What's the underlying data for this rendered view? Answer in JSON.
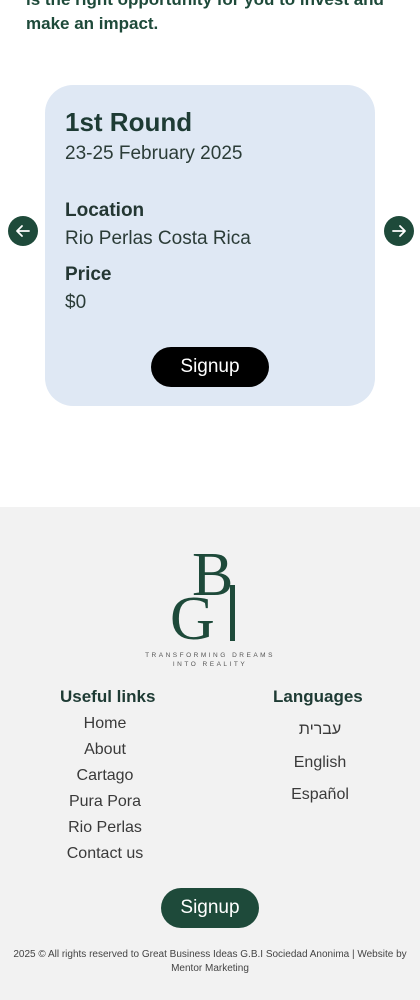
{
  "intro_text": "is the right opportunity for you to invest and make an impact.",
  "card": {
    "title": "1st Round",
    "date": "23-25 February 2025",
    "location_label": "Location",
    "location_value": "Rio Perlas Costa Rica",
    "price_label": "Price",
    "price_value": "$0",
    "signup_label": "Signup"
  },
  "carousel": {
    "prev_icon": "arrow-left-icon",
    "next_icon": "arrow-right-icon"
  },
  "logo": {
    "letters": "BGI",
    "tagline": "TRANSFORMING DREAMS INTO REALITY"
  },
  "useful_links": {
    "title": "Useful links",
    "items": [
      "Home",
      "About",
      "Cartago",
      "Pura Pora",
      "Rio Perlas",
      "Contact us"
    ]
  },
  "languages": {
    "title": "Languages",
    "items": [
      "עברית",
      "English",
      "Español"
    ]
  },
  "footer_signup": "Signup",
  "copyright": "2025 © All rights reserved to Great Business Ideas G.B.I Sociedad Anonima | Website by Mentor Marketing",
  "colors": {
    "brand_green": "#1e4a3a",
    "card_bg": "#dfe8f4",
    "footer_bg": "#f2f2f2"
  }
}
